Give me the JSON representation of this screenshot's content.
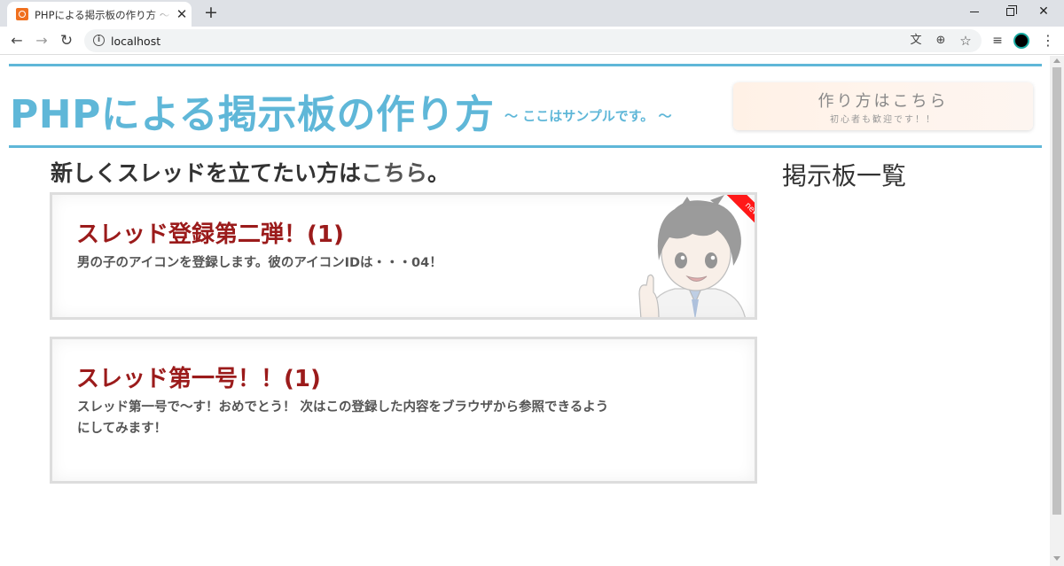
{
  "browser": {
    "tab_title": "PHPによる掲示板の作り方 ～ここは",
    "url": "localhost"
  },
  "header": {
    "title": "PHPによる掲示板の作り方",
    "subtitle": "～ ここはサンプルです。 ～"
  },
  "howto": {
    "title": "作り方はこちら",
    "subtitle": "初心者も歓迎です！！"
  },
  "new_thread": {
    "prefix": "新しくスレッドを立てたい方は",
    "link": "こちら",
    "suffix": "。"
  },
  "sidebar": {
    "title": "掲示板一覧"
  },
  "threads": [
    {
      "title": "スレッド登録第二弾！(1)",
      "body": "男の子のアイコンを登録します。彼のアイコンIDは・・・04！",
      "badge": "new"
    },
    {
      "title": "スレッド第一号！！(1)",
      "body": "スレッド第一号で～す！おめでとう！ 次はこの登録した内容をブラウザから参照できるようにしてみます！"
    }
  ],
  "colors": {
    "accent": "#5fb7d8",
    "thread_title": "#9b1b1b",
    "badge": "#ff1818"
  }
}
